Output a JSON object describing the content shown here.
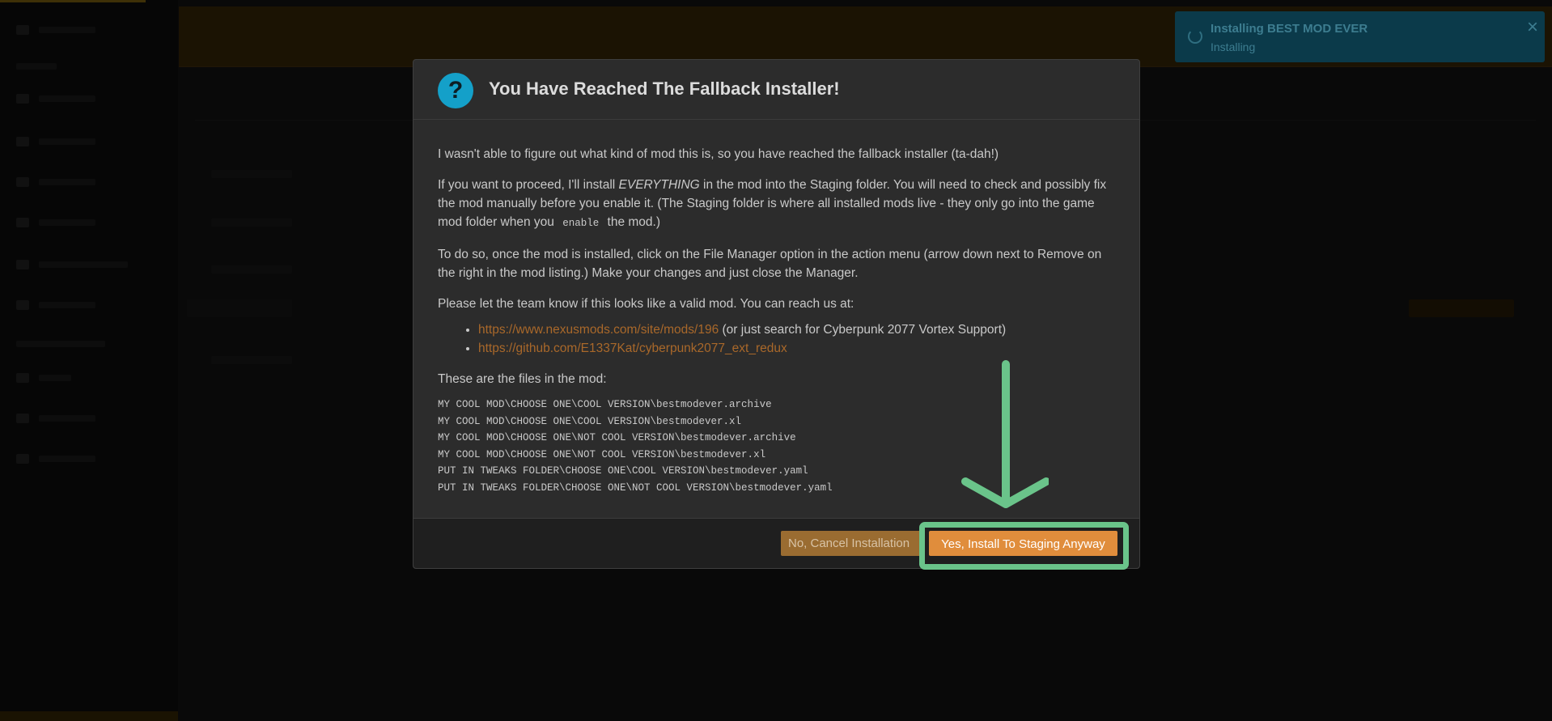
{
  "toast": {
    "title": "Installing BEST MOD EVER",
    "subtitle": "Installing",
    "close_icon": "×"
  },
  "dialog": {
    "icon": "?",
    "title": "You Have Reached The Fallback Installer!",
    "p1": "I wasn't able to figure out what kind of mod this is, so you have reached the fallback installer (ta-dah!)",
    "p2_a": "If you want to proceed, I'll install ",
    "p2_em": "EVERYTHING",
    "p2_b": " in the mod into the Staging folder. You will need to check and possibly fix the mod manually before you enable it. (The Staging folder is where all installed mods live - they only go into the game mod folder when you ",
    "p2_code": "enable",
    "p2_c": " the mod.)",
    "p3": "To do so, once the mod is installed, click on the File Manager option in the action menu (arrow down next to Remove on the right in the mod listing.) Make your changes and just close the Manager.",
    "p4": "Please let the team know if this looks like a valid mod. You can reach us at:",
    "links": [
      {
        "url": "https://www.nexusmods.com/site/mods/196",
        "suffix": " (or just search for Cyberpunk 2077 Vortex Support)"
      },
      {
        "url": "https://github.com/E1337Kat/cyberpunk2077_ext_redux",
        "suffix": ""
      }
    ],
    "files_heading": "These are the files in the mod:",
    "files": [
      "MY COOL MOD\\CHOOSE ONE\\COOL VERSION\\bestmodever.archive",
      "MY COOL MOD\\CHOOSE ONE\\COOL VERSION\\bestmodever.xl",
      "MY COOL MOD\\CHOOSE ONE\\NOT COOL VERSION\\bestmodever.archive",
      "MY COOL MOD\\CHOOSE ONE\\NOT COOL VERSION\\bestmodever.xl",
      "PUT IN TWEAKS FOLDER\\CHOOSE ONE\\COOL VERSION\\bestmodever.yaml",
      "PUT IN TWEAKS FOLDER\\CHOOSE ONE\\NOT COOL VERSION\\bestmodever.yaml"
    ],
    "cancel_label": "No, Cancel Installation",
    "confirm_label": "Yes, Install To Staging Anyway"
  },
  "colors": {
    "accent": "#e08d3c",
    "info": "#14a0c9",
    "annotation": "#6ac48a"
  }
}
